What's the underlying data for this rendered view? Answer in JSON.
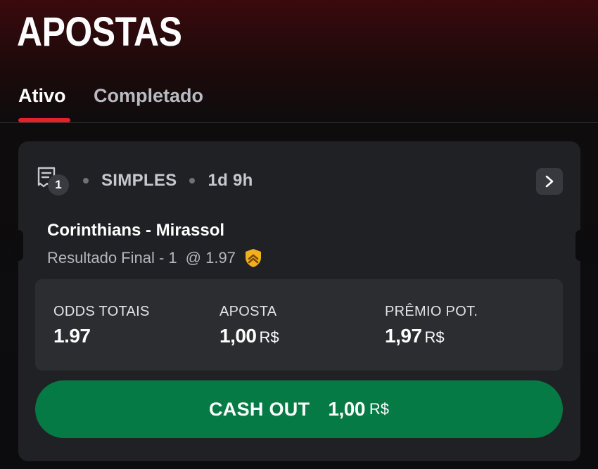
{
  "header": {
    "title": "APOSTAS"
  },
  "tabs": [
    {
      "label": "Ativo",
      "active": true
    },
    {
      "label": "Completado",
      "active": false
    }
  ],
  "bet": {
    "ticket_count": "1",
    "type": "SIMPLES",
    "time_left": "1d 9h",
    "match": "Corinthians - Mirassol",
    "selection": "Resultado Final - 1",
    "selection_odds": "@ 1.97",
    "boost_icon": "chevron-up-shield-icon",
    "summary": {
      "total_odds_label": "ODDS TOTAIS",
      "total_odds_value": "1.97",
      "stake_label": "APOSTA",
      "stake_value": "1,00",
      "stake_currency": "R$",
      "potential_label": "PRÊMIO POT.",
      "potential_value": "1,97",
      "potential_currency": "R$"
    },
    "cashout": {
      "label": "CASH OUT",
      "amount": "1,00",
      "currency": "R$"
    }
  },
  "colors": {
    "accent_red": "#e3212b",
    "cashout_green": "#067a44",
    "card_bg": "#202124",
    "boost_gold": "#f2b01e"
  }
}
